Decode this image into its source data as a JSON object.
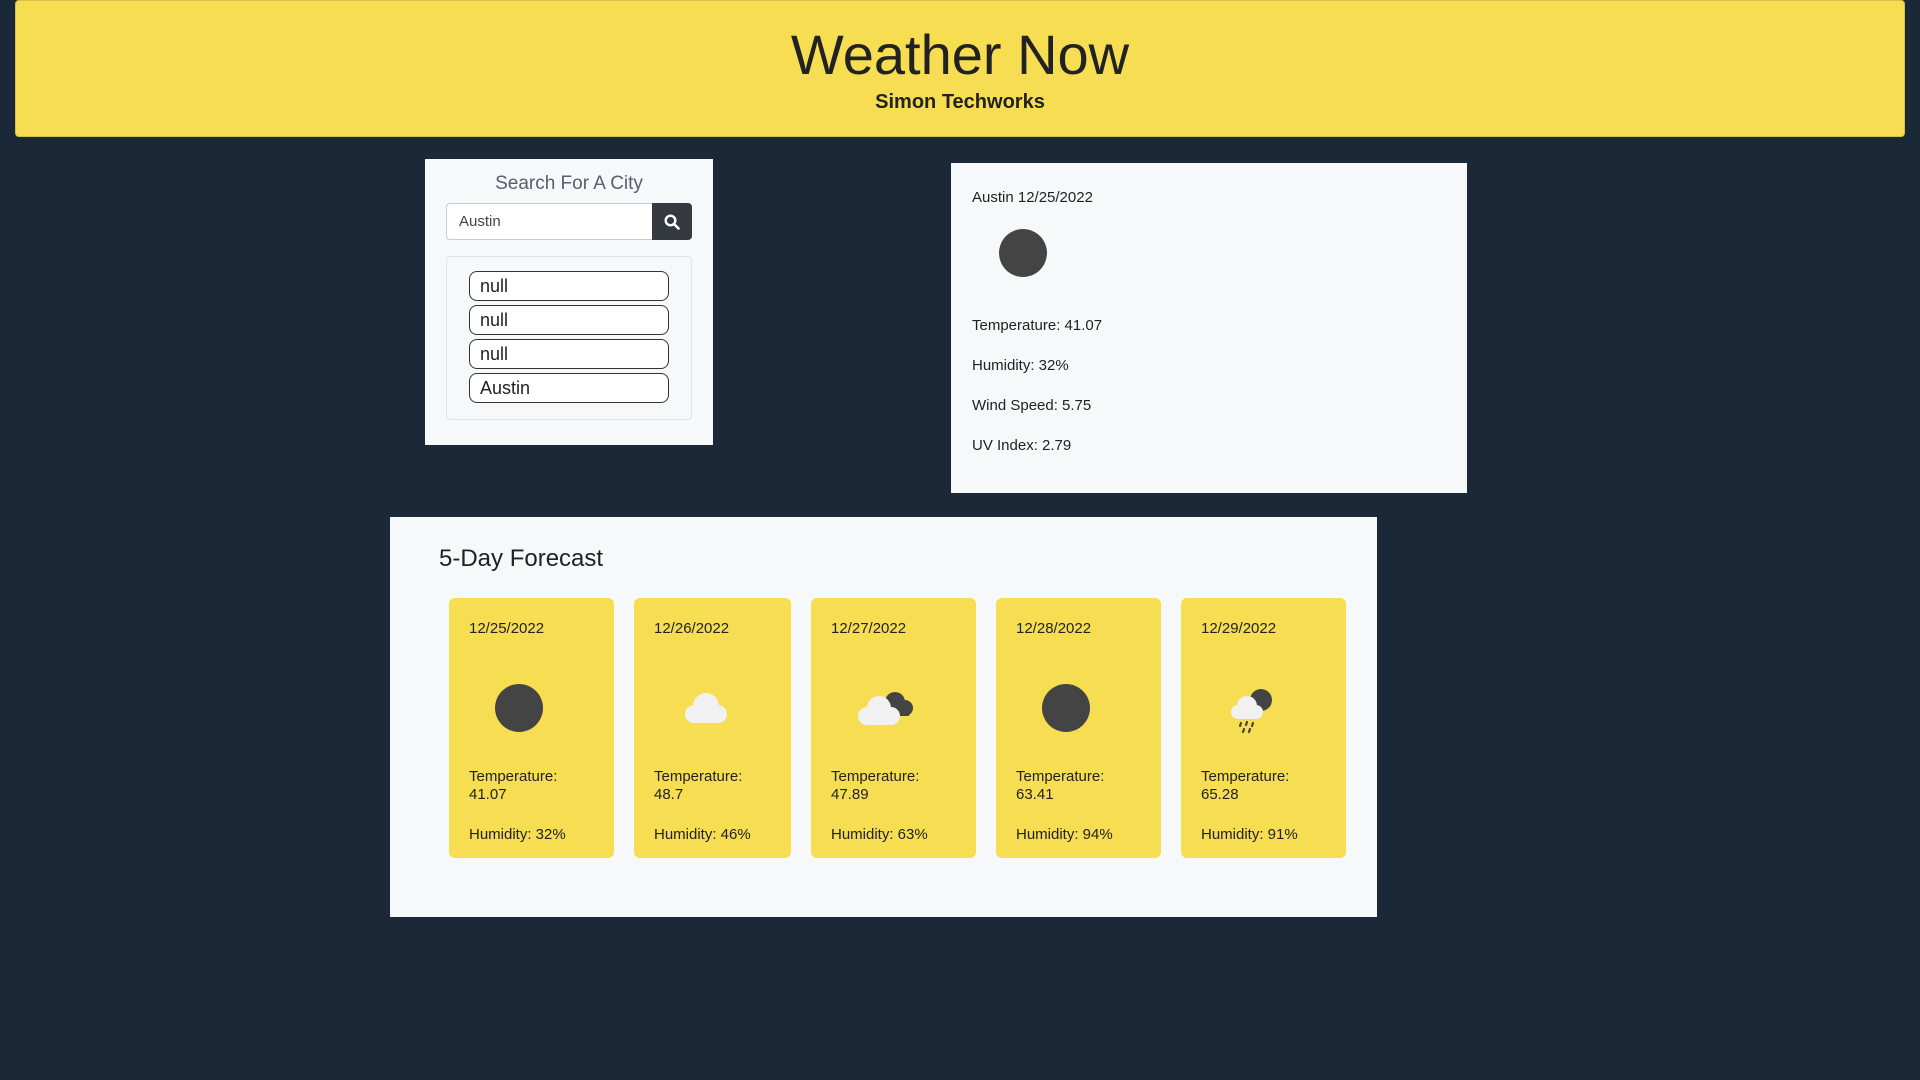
{
  "header": {
    "title": "Weather Now",
    "subtitle": "Simon Techworks"
  },
  "search": {
    "heading": "Search For A City",
    "input_value": "Austin",
    "button_icon": "search-icon",
    "history": [
      "null",
      "null",
      "null",
      "Austin"
    ]
  },
  "current": {
    "title": "Austin 12/25/2022",
    "icon": "sun-icon",
    "temperature": "Temperature: 41.07",
    "humidity": "Humidity: 32%",
    "wind": "Wind Speed: 5.75",
    "uv": "UV Index: 2.79"
  },
  "forecast": {
    "title": "5-Day Forecast",
    "days": [
      {
        "date": "12/25/2022",
        "icon": "sun-icon",
        "temperature": "Temperature: 41.07",
        "humidity": "Humidity: 32%"
      },
      {
        "date": "12/26/2022",
        "icon": "cloud-icon",
        "temperature": "Temperature: 48.7",
        "humidity": "Humidity: 46%"
      },
      {
        "date": "12/27/2022",
        "icon": "broken-clouds-icon",
        "temperature": "Temperature: 47.89",
        "humidity": "Humidity: 63%"
      },
      {
        "date": "12/28/2022",
        "icon": "sun-icon",
        "temperature": "Temperature: 63.41",
        "humidity": "Humidity: 94%"
      },
      {
        "date": "12/29/2022",
        "icon": "rain-icon",
        "temperature": "Temperature: 65.28",
        "humidity": "Humidity: 91%"
      }
    ]
  },
  "colors": {
    "background": "#1b2838",
    "accent": "#f6dd52",
    "panel": "#f7f8fa",
    "icon_dark": "#444444",
    "cloud": "#f1f1f1"
  }
}
